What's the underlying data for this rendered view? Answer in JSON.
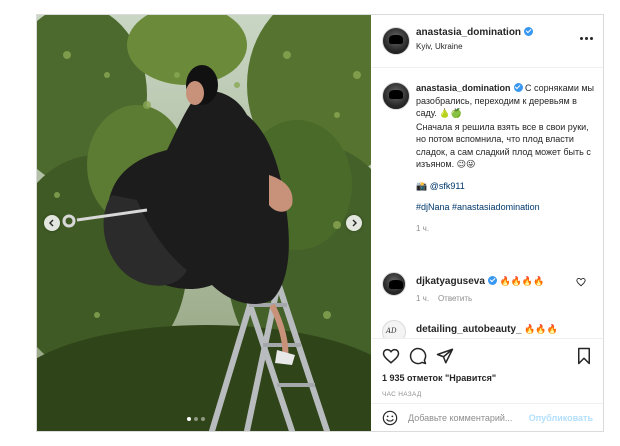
{
  "post": {
    "username": "anastasia_domination",
    "location": "Kyiv, Ukraine"
  },
  "caption": {
    "username": "anastasia_domination",
    "text_1": "С сорняками мы разобрались, переходим к деревьям в саду.",
    "emoji_1": "🍐🍏",
    "text_2": "Сначала я решила взять все в свои руки, но потом вспомнила, что плод власти сладок, а сам сладкий плод может быть с изъяном.",
    "emoji_2": "😉😜",
    "camera_emoji": "📸",
    "credit": "@sfk911",
    "hashtags": "#djNana #anastasiadomination",
    "time": "1 ч."
  },
  "comments": [
    {
      "username": "djkatyaguseva",
      "emojis": "🔥🔥🔥🔥",
      "time": "1 ч.",
      "reply": "Ответить"
    },
    {
      "username": "detailing_autobeauty_",
      "emojis": "🔥🔥🔥",
      "avatar_text": "AD"
    }
  ],
  "likes": "1 935 отметок \"Нравится\"",
  "post_time": "ЧАС НАЗАД",
  "add_comment": {
    "placeholder": "Добавьте комментарий...",
    "publish": "Опубликовать"
  },
  "icons": [
    "heart-icon",
    "comment-icon",
    "share-icon",
    "bookmark-icon",
    "more-icon",
    "smile-icon",
    "verified-icon",
    "chevron-left-icon",
    "chevron-right-icon"
  ],
  "colors": {
    "verified": "#3897f0",
    "link": "#00376b",
    "publish_disabled": "#b2dffc"
  },
  "carousel": {
    "slides": 3,
    "active_slide": 1
  }
}
